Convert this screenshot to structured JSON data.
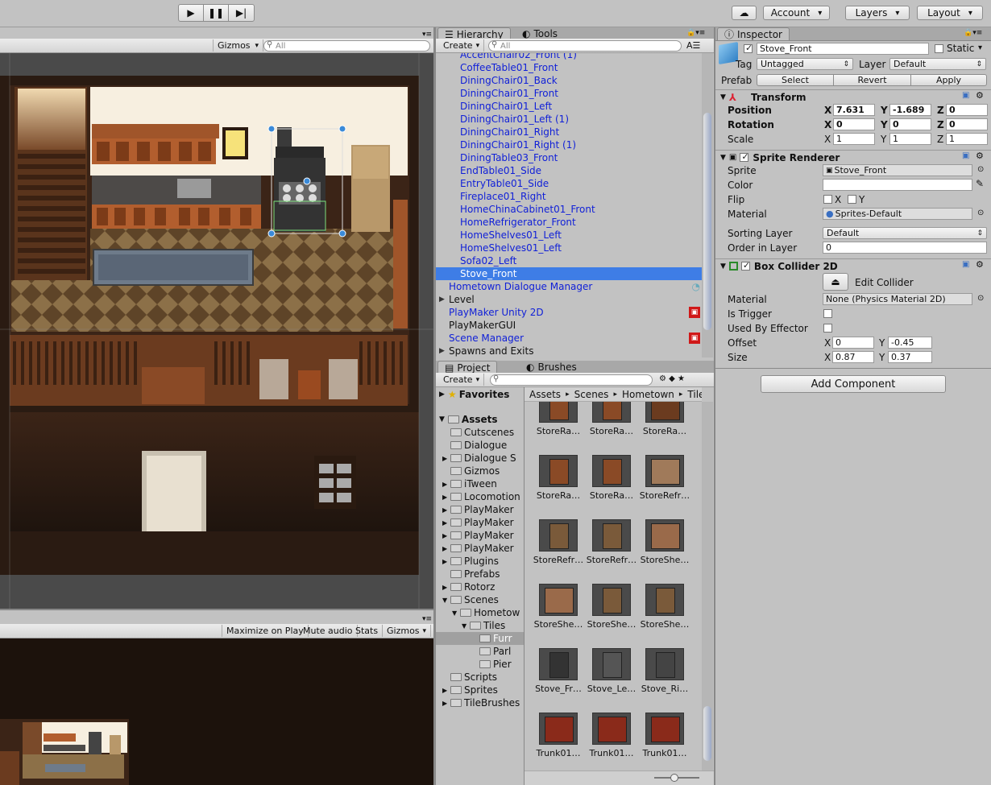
{
  "toolbar": {
    "account": "Account",
    "layers": "Layers",
    "layout": "Layout"
  },
  "scene": {
    "gizmos": "Gizmos",
    "search_placeholder": "All"
  },
  "game": {
    "maximize": "Maximize on Play",
    "mute": "Mute audio",
    "stats": "Stats",
    "gizmos": "Gizmos"
  },
  "hierarchy": {
    "tab": "Hierarchy",
    "tab2": "Tools",
    "create": "Create",
    "search_placeholder": "All",
    "items": [
      {
        "label": "AccentChair02_Front (1)",
        "indent": 1
      },
      {
        "label": "CoffeeTable01_Front",
        "indent": 1
      },
      {
        "label": "DiningChair01_Back",
        "indent": 1
      },
      {
        "label": "DiningChair01_Front",
        "indent": 1
      },
      {
        "label": "DiningChair01_Left",
        "indent": 1
      },
      {
        "label": "DiningChair01_Left (1)",
        "indent": 1
      },
      {
        "label": "DiningChair01_Right",
        "indent": 1
      },
      {
        "label": "DiningChair01_Right (1)",
        "indent": 1
      },
      {
        "label": "DiningTable03_Front",
        "indent": 1
      },
      {
        "label": "EndTable01_Side",
        "indent": 1
      },
      {
        "label": "EntryTable01_Side",
        "indent": 1
      },
      {
        "label": "Fireplace01_Right",
        "indent": 1
      },
      {
        "label": "HomeChinaCabinet01_Front",
        "indent": 1
      },
      {
        "label": "HomeRefrigerator_Front",
        "indent": 1
      },
      {
        "label": "HomeShelves01_Left",
        "indent": 1
      },
      {
        "label": "HomeShelves01_Left",
        "indent": 1
      },
      {
        "label": "Sofa02_Left",
        "indent": 1
      },
      {
        "label": "Stove_Front",
        "indent": 1
      },
      {
        "label": "Hometown Dialogue Manager",
        "indent": 0
      },
      {
        "label": "Level",
        "indent": 0
      },
      {
        "label": "PlayMaker Unity 2D",
        "indent": 0
      },
      {
        "label": "PlayMakerGUI",
        "indent": 0
      },
      {
        "label": "Scene Manager",
        "indent": 0
      },
      {
        "label": "Spawns and Exits",
        "indent": 0
      }
    ]
  },
  "project": {
    "tab": "Project",
    "tab2": "Brushes",
    "create": "Create",
    "favorites": "Favorites",
    "assets": "Assets",
    "breadcrumb": [
      "Assets",
      "Scenes",
      "Hometown",
      "Tiles"
    ],
    "folders": [
      {
        "label": "Cutscenes",
        "depth": 1
      },
      {
        "label": "Dialogue",
        "depth": 1
      },
      {
        "label": "Dialogue S",
        "depth": 1
      },
      {
        "label": "Gizmos",
        "depth": 1
      },
      {
        "label": "iTween",
        "depth": 1
      },
      {
        "label": "Locomotion",
        "depth": 1
      },
      {
        "label": "PlayMaker",
        "depth": 1
      },
      {
        "label": "PlayMaker",
        "depth": 1
      },
      {
        "label": "PlayMaker",
        "depth": 1
      },
      {
        "label": "PlayMaker",
        "depth": 1
      },
      {
        "label": "Plugins",
        "depth": 1
      },
      {
        "label": "Prefabs",
        "depth": 1
      },
      {
        "label": "Rotorz",
        "depth": 1
      },
      {
        "label": "Scenes",
        "depth": 1
      },
      {
        "label": "Hometow",
        "depth": 2
      },
      {
        "label": "Tiles",
        "depth": 3
      },
      {
        "label": "Furr",
        "depth": 4
      },
      {
        "label": "Parl",
        "depth": 4
      },
      {
        "label": "Pier",
        "depth": 4
      },
      {
        "label": "Scripts",
        "depth": 1
      },
      {
        "label": "Sprites",
        "depth": 1
      },
      {
        "label": "TileBrushes",
        "depth": 1
      }
    ],
    "assets_grid": [
      "StoreRa…",
      "StoreRa…",
      "StoreRa…",
      "StoreRa…",
      "StoreRa…",
      "StoreRefr…",
      "StoreRefr…",
      "StoreRefr…",
      "StoreShe…",
      "StoreShe…",
      "StoreShe…",
      "StoreShe…",
      "Stove_Fr…",
      "Stove_Le…",
      "Stove_Ri…",
      "Trunk01…",
      "Trunk01…",
      "Trunk01…"
    ]
  },
  "inspector": {
    "tab": "Inspector",
    "name": "Stove_Front",
    "static": "Static",
    "tag_label": "Tag",
    "tag": "Untagged",
    "layer_label": "Layer",
    "layer": "Default",
    "prefab_label": "Prefab",
    "select": "Select",
    "revert": "Revert",
    "apply": "Apply",
    "transform": {
      "title": "Transform",
      "position": "Position",
      "rotation": "Rotation",
      "scale": "Scale",
      "pos": [
        "7.631",
        "-1.689",
        "0"
      ],
      "rot": [
        "0",
        "0",
        "0"
      ],
      "scl": [
        "1",
        "1",
        "1"
      ]
    },
    "sprite_renderer": {
      "title": "Sprite Renderer",
      "sprite_label": "Sprite",
      "sprite": "Stove_Front",
      "color_label": "Color",
      "flip_label": "Flip",
      "material_label": "Material",
      "material": "Sprites-Default",
      "sorting_label": "Sorting Layer",
      "sorting": "Default",
      "order_label": "Order in Layer",
      "order": "0"
    },
    "box_collider": {
      "title": "Box Collider 2D",
      "edit": "Edit Collider",
      "material_label": "Material",
      "material": "None (Physics Material 2D)",
      "trigger_label": "Is Trigger",
      "effector_label": "Used By Effector",
      "offset_label": "Offset",
      "offset": [
        "0",
        "-0.45"
      ],
      "size_label": "Size",
      "size": [
        "0.87",
        "0.37"
      ]
    },
    "add_component": "Add Component"
  },
  "axes": {
    "x": "X",
    "y": "Y",
    "z": "Z"
  }
}
